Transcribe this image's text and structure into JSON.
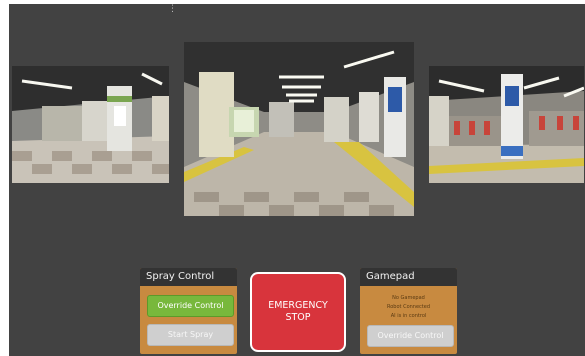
{
  "colors": {
    "background": "#424242",
    "panel_fill": "#c88a40",
    "panel_header": "#333333",
    "override_green": "#78b83c",
    "button_grey": "#cfcfcf",
    "emergency_red": "#d8343c"
  },
  "toolbar": {
    "handle_glyph": "⋮"
  },
  "spray_control": {
    "title": "Spray Control",
    "override_label": "Override Control",
    "start_label": "Start Spray"
  },
  "emergency": {
    "line1": "EMERGENCY",
    "line2": "STOP"
  },
  "gamepad": {
    "title": "Gamepad",
    "status_lines": [
      "No Gamepad",
      "Robot Connected",
      "AI is in control"
    ],
    "override_label": "Override Control"
  }
}
